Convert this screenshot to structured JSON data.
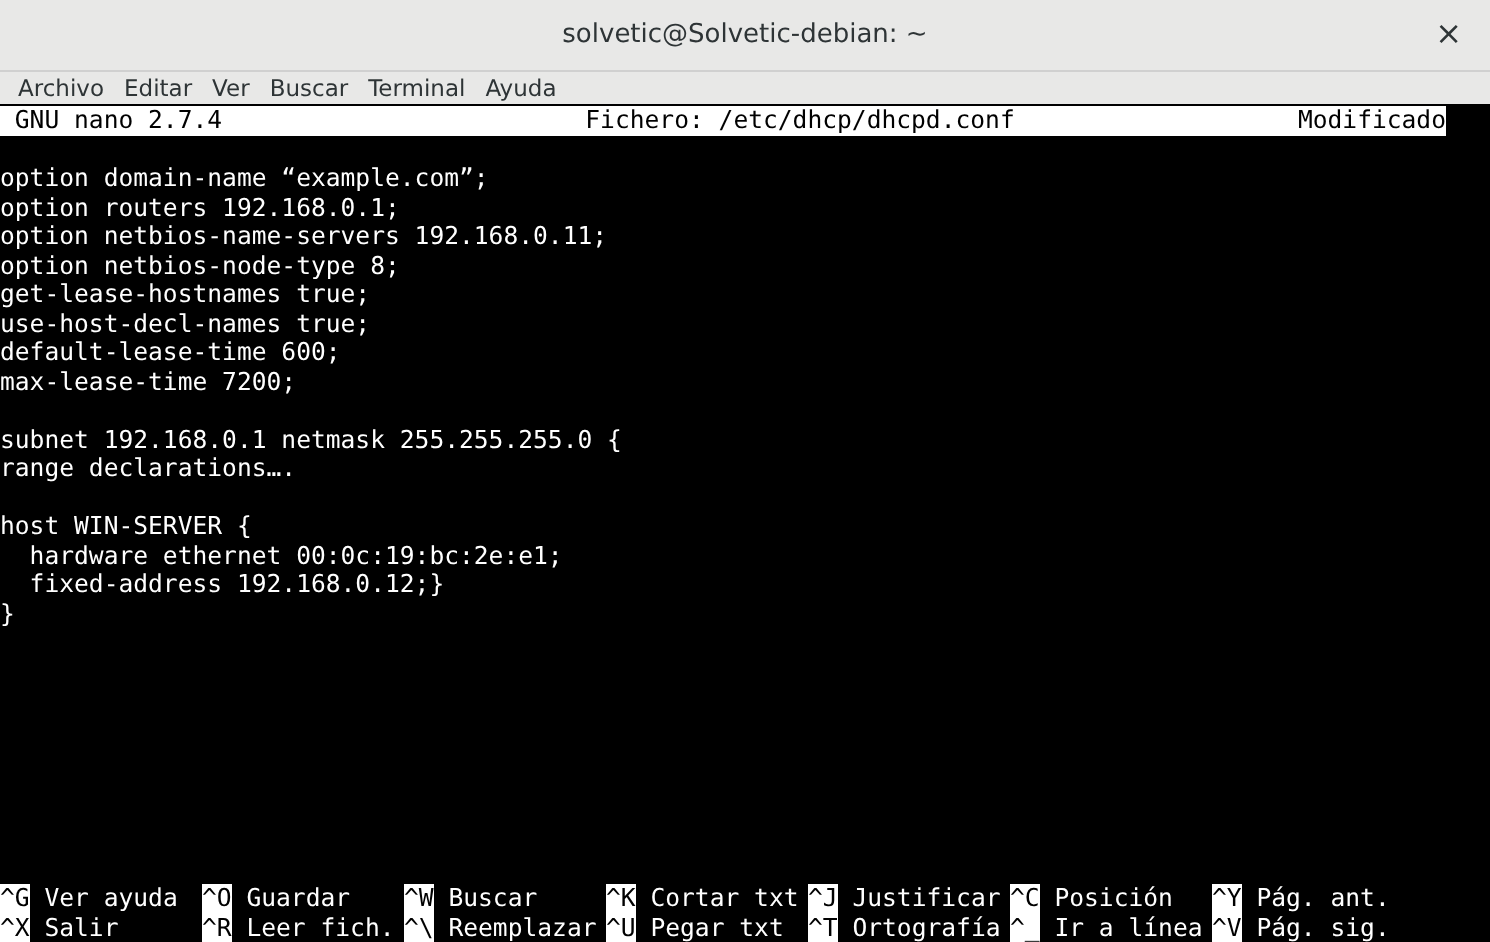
{
  "window": {
    "title": "solvetic@Solvetic-debian: ~",
    "close": "×"
  },
  "menu": [
    "Archivo",
    "Editar",
    "Ver",
    "Buscar",
    "Terminal",
    "Ayuda"
  ],
  "nano_header": {
    "version": "GNU nano 2.7.4",
    "file": "Fichero: /etc/dhcp/dhcpd.conf",
    "status": "Modificado"
  },
  "blocks": [
    [
      "option domain-name “example.com”;",
      "option routers 192.168.0.1;",
      "option netbios-name-servers 192.168.0.11;",
      "option netbios-node-type 8;",
      "get-lease-hostnames true;",
      "use-host-decl-names true;",
      "default-lease-time 600;",
      "max-lease-time 7200;"
    ],
    [
      "subnet 192.168.0.1 netmask 255.255.255.0 {",
      "range declarations…."
    ],
    [
      "host WIN-SERVER {",
      "  hardware ethernet 00:0c:19:bc:2e:e1;",
      "  fixed-address 192.168.0.12;}",
      "}"
    ]
  ],
  "shortcuts": [
    [
      {
        "key": "^G",
        "label": "Ver ayuda"
      },
      {
        "key": "^O",
        "label": "Guardar"
      },
      {
        "key": "^W",
        "label": "Buscar"
      },
      {
        "key": "^K",
        "label": "Cortar txt"
      },
      {
        "key": "^J",
        "label": "Justificar"
      },
      {
        "key": "^C",
        "label": "Posición"
      },
      {
        "key": "^Y",
        "label": "Pág. ant."
      }
    ],
    [
      {
        "key": "^X",
        "label": "Salir"
      },
      {
        "key": "^R",
        "label": "Leer fich."
      },
      {
        "key": "^\\",
        "label": "Reemplazar"
      },
      {
        "key": "^U",
        "label": "Pegar txt"
      },
      {
        "key": "^T",
        "label": "Ortografía"
      },
      {
        "key": "^_",
        "label": "Ir a línea"
      },
      {
        "key": "^V",
        "label": "Pág. sig."
      }
    ]
  ]
}
